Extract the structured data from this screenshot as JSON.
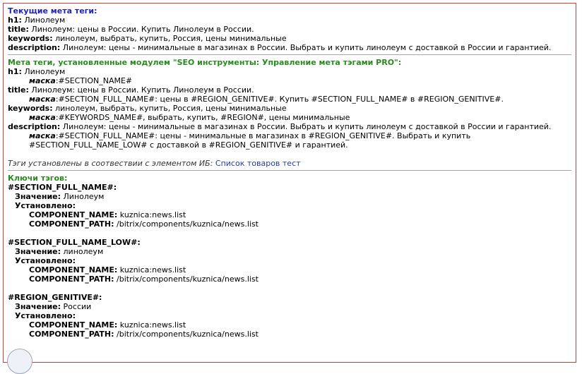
{
  "current": {
    "heading": "Текущие мета теги:",
    "h1_label": "h1:",
    "h1_value": "Линолеум",
    "title_label": "title:",
    "title_value": "Линолеум: цены в России. Купить Линолеум в России.",
    "keywords_label": "keywords:",
    "keywords_value": "линолеум, выбрать, купить, Россия, цены минимальные",
    "description_label": "description:",
    "description_value": "Линолеум: цены - минимальные в магазинах в России. Выбрать и купить линолеум с доставкой в России и гарантией."
  },
  "module": {
    "heading": "Мета теги, установленные модулем \"SEO инструменты: Управление мета тэгами PRO\":",
    "mask_label": "маска",
    "h1_label": "h1:",
    "h1_value": "Линолеум",
    "h1_mask": ":#SECTION_NAME#",
    "title_label": "title:",
    "title_value": "Линолеум: цены в России. Купить Линолеум в России.",
    "title_mask": ":#SECTION_FULL_NAME#: цены в #REGION_GENITIVE#. Купить #SECTION_FULL_NAME# в #REGION_GENITIVE#.",
    "keywords_label": "keywords:",
    "keywords_value": "линолеум, выбрать, купить, Россия, цены минимальные",
    "keywords_mask": ":#KEYWORDS_NAME#, выбрать, купить, #REGION#, цены минимальные",
    "description_label": "description:",
    "description_value": "Линолеум: цены - минимальные в магазинах в России. Выбрать и купить линолеум с доставкой в России и гарантией.",
    "description_mask_1": ":#SECTION_FULL_NAME#: цены - минимальные в магазинах в #REGION_GENITIVE#. Выбрать и купить",
    "description_mask_2": "#SECTION_FULL_NAME_LOW# с доставкой в #REGION_GENITIVE# и гарантией.",
    "note_text": "Тэги установлены в соотвествии с элементом ИБ:",
    "note_link": "Список товаров тест"
  },
  "keys": {
    "heading": "Ключи тэгов:",
    "value_label": "Значение:",
    "installed_label": "Установлено:",
    "component_name_label": "COMPONENT_NAME:",
    "component_path_label": "COMPONENT_PATH:",
    "items": [
      {
        "name": "#SECTION_FULL_NAME#:",
        "value": "Линолеум",
        "component_name": "kuznica:news.list",
        "component_path": "/bitrix/components/kuznica/news.list"
      },
      {
        "name": "#SECTION_FULL_NAME_LOW#:",
        "value": "линолеум",
        "component_name": "kuznica:news.list",
        "component_path": "/bitrix/components/kuznica/news.list"
      },
      {
        "name": "#REGION_GENITIVE#:",
        "value": "России",
        "component_name": "kuznica:news.list",
        "component_path": "/bitrix/components/kuznica/news.list"
      }
    ]
  },
  "colors": {
    "border": "#c9403f",
    "heading_blue": "#1f1fc7",
    "heading_green": "#2a8a1f",
    "link": "#1f3da0"
  }
}
